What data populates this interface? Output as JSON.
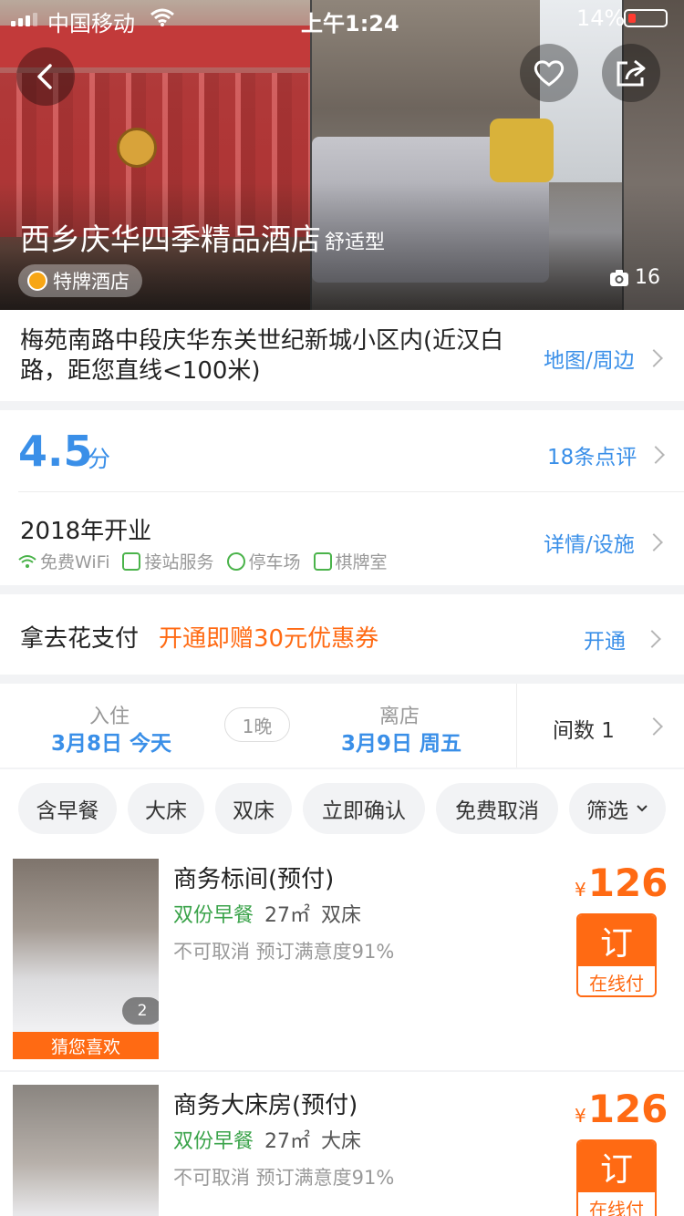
{
  "status": {
    "carrier": "中国移动",
    "time": "上午1:24",
    "battery": "14%"
  },
  "hero": {
    "hotel_name": "西乡庆华四季精品酒店",
    "hotel_type": "舒适型",
    "brand_tag": "特牌酒店",
    "photo_count": "16",
    "icons": [
      "back-icon",
      "heart-icon",
      "share-icon",
      "camera-icon"
    ]
  },
  "address": {
    "text": "梅苑南路中段庆华东关世纪新城小区内(近汉白路，距您直线<100米)",
    "link": "地图/周边"
  },
  "rating": {
    "score": "4.5",
    "unit": "分",
    "reviews_link": "18条点评",
    "opened": "2018年开业",
    "details_link": "详情/设施",
    "amenities": [
      "免费WiFi",
      "接站服务",
      "停车场",
      "棋牌室"
    ]
  },
  "payment": {
    "title": "拿去花支付",
    "promo": "开通即赠30元优惠券",
    "action": "开通"
  },
  "dates": {
    "checkin_label": "入住",
    "checkin_date": "3月8日 今天",
    "nights": "1晚",
    "checkout_label": "离店",
    "checkout_date": "3月9日 周五",
    "rooms": "间数 1"
  },
  "filters": [
    "含早餐",
    "大床",
    "双床",
    "立即确认",
    "免费取消",
    "筛选"
  ],
  "rooms": [
    {
      "name": "商务标间(预付)",
      "breakfast": "双份早餐",
      "area": "27㎡",
      "bed": "双床",
      "note": "不可取消 预订满意度91%",
      "currency": "¥",
      "price": "126",
      "book": "订",
      "pay": "在线付",
      "photo_count": "2",
      "badge": "猜您喜欢"
    },
    {
      "name": "商务大床房(预付)",
      "breakfast": "双份早餐",
      "area": "27㎡",
      "bed": "大床",
      "note": "不可取消 预订满意度91%",
      "currency": "¥",
      "price": "126",
      "book": "订",
      "pay": "在线付"
    }
  ],
  "colors": {
    "accent_blue": "#3a8fe8",
    "accent_orange": "#ff6a13",
    "green": "#3aa34a"
  }
}
